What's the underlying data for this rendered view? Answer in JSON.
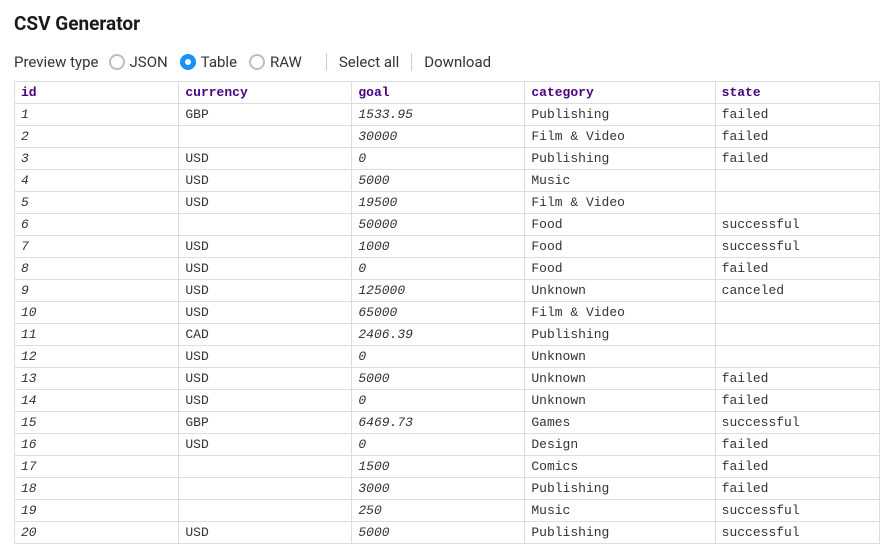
{
  "title": "CSV Generator",
  "toolbar": {
    "preview_label": "Preview type",
    "options": {
      "json": "JSON",
      "table": "Table",
      "raw": "RAW"
    },
    "selected": "table",
    "select_all": "Select all",
    "download": "Download"
  },
  "table": {
    "headers": {
      "id": "id",
      "currency": "currency",
      "goal": "goal",
      "category": "category",
      "state": "state"
    },
    "rows": [
      {
        "id": "1",
        "currency": "GBP",
        "goal": "1533.95",
        "category": "Publishing",
        "state": "failed"
      },
      {
        "id": "2",
        "currency": "",
        "goal": "30000",
        "category": "Film & Video",
        "state": "failed"
      },
      {
        "id": "3",
        "currency": "USD",
        "goal": "0",
        "category": "Publishing",
        "state": "failed"
      },
      {
        "id": "4",
        "currency": "USD",
        "goal": "5000",
        "category": "Music",
        "state": ""
      },
      {
        "id": "5",
        "currency": "USD",
        "goal": "19500",
        "category": "Film & Video",
        "state": ""
      },
      {
        "id": "6",
        "currency": "",
        "goal": "50000",
        "category": "Food",
        "state": "successful"
      },
      {
        "id": "7",
        "currency": "USD",
        "goal": "1000",
        "category": "Food",
        "state": "successful"
      },
      {
        "id": "8",
        "currency": "USD",
        "goal": "0",
        "category": "Food",
        "state": "failed"
      },
      {
        "id": "9",
        "currency": "USD",
        "goal": "125000",
        "category": "Unknown",
        "state": "canceled"
      },
      {
        "id": "10",
        "currency": "USD",
        "goal": "65000",
        "category": "Film & Video",
        "state": ""
      },
      {
        "id": "11",
        "currency": "CAD",
        "goal": "2406.39",
        "category": "Publishing",
        "state": ""
      },
      {
        "id": "12",
        "currency": "USD",
        "goal": "0",
        "category": "Unknown",
        "state": ""
      },
      {
        "id": "13",
        "currency": "USD",
        "goal": "5000",
        "category": "Unknown",
        "state": "failed"
      },
      {
        "id": "14",
        "currency": "USD",
        "goal": "0",
        "category": "Unknown",
        "state": "failed"
      },
      {
        "id": "15",
        "currency": "GBP",
        "goal": "6469.73",
        "category": "Games",
        "state": "successful"
      },
      {
        "id": "16",
        "currency": "USD",
        "goal": "0",
        "category": "Design",
        "state": "failed"
      },
      {
        "id": "17",
        "currency": "",
        "goal": "1500",
        "category": "Comics",
        "state": "failed"
      },
      {
        "id": "18",
        "currency": "",
        "goal": "3000",
        "category": "Publishing",
        "state": "failed"
      },
      {
        "id": "19",
        "currency": "",
        "goal": "250",
        "category": "Music",
        "state": "successful"
      },
      {
        "id": "20",
        "currency": "USD",
        "goal": "5000",
        "category": "Publishing",
        "state": "successful"
      }
    ]
  }
}
